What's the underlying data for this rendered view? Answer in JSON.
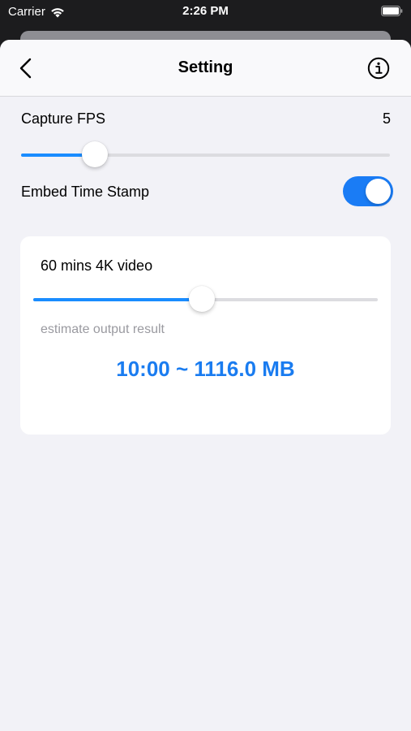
{
  "status_bar": {
    "carrier": "Carrier",
    "time": "2:26 PM"
  },
  "nav": {
    "title": "Setting",
    "back_icon": "chevron-left-icon",
    "info_icon": "info-circle-icon"
  },
  "capture_fps": {
    "label": "Capture FPS",
    "value": "5",
    "slider_fraction": 0.2
  },
  "embed_time_stamp": {
    "label": "Embed Time Stamp",
    "enabled": true
  },
  "estimate_card": {
    "title": "60 mins 4K video",
    "slider_fraction": 0.49,
    "subtitle": "estimate output result",
    "result": "10:00 ~ 1116.0 MB"
  },
  "colors": {
    "accent": "#1a8cff",
    "result_text": "#1a7cf0",
    "background": "#f2f2f7"
  }
}
